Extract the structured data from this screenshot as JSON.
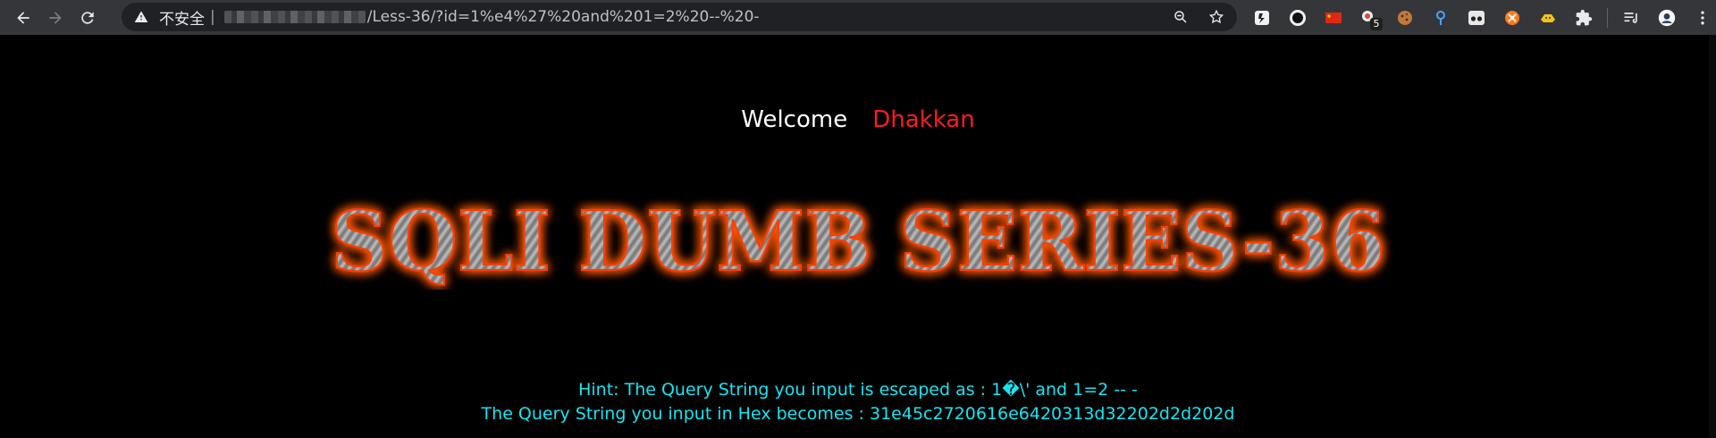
{
  "browser": {
    "security_label": "不安全",
    "separator": "|",
    "url_path": "/Less-36/?id=1%e4%27%20and%201=2%20--%20-",
    "extensions": [
      {
        "name": "extension-dark-icon"
      },
      {
        "name": "extension-circle-icon"
      },
      {
        "name": "extension-flag-icon"
      },
      {
        "name": "extension-badge-icon",
        "badge": "5"
      },
      {
        "name": "extension-cookie-icon"
      },
      {
        "name": "extension-pin-icon"
      },
      {
        "name": "extension-glasses-icon"
      },
      {
        "name": "extension-orange-icon"
      },
      {
        "name": "extension-yellow-icon"
      },
      {
        "name": "extensions-puzzle-icon"
      }
    ]
  },
  "page": {
    "welcome_label": "Welcome",
    "user_name": "Dhakkan",
    "title": "SQLI DUMB SERIES-36",
    "hint_line1": "Hint: The Query String you input is escaped as : 1�\\' and 1=2 -- -",
    "hint_line2": "The Query String you input in Hex becomes : 31e45c2720616e6420313d32202d2d202d"
  },
  "colors": {
    "chrome_bg": "#35363a",
    "omnibox_bg": "#202124",
    "page_bg": "#000000",
    "welcome": "#ffffff",
    "user": "#ff1c1c",
    "hint": "#19e3f2",
    "title_glow": "#ff5a00"
  }
}
